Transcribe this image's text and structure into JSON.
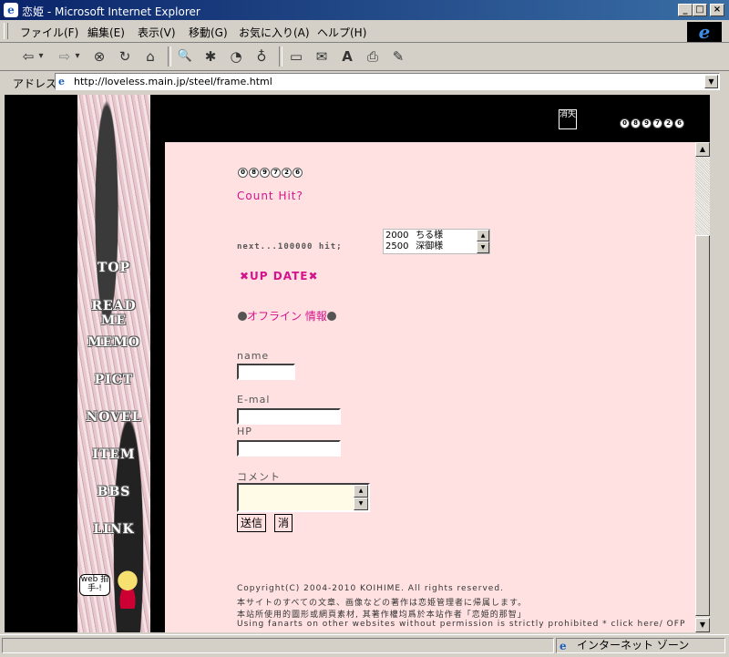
{
  "window": {
    "title": "恋姫 - Microsoft Internet Explorer",
    "controls": {
      "minimize": "_",
      "maximize": "□",
      "close": "×"
    }
  },
  "menubar": {
    "items": [
      "ファイル(F)",
      "編集(E)",
      "表示(V)",
      "移動(G)",
      "お気に入り(A)",
      "ヘルプ(H)"
    ]
  },
  "toolbar": {
    "buttons": [
      {
        "name": "back-icon",
        "glyph": "⇦"
      },
      {
        "name": "back-dropdown-icon",
        "glyph": "▾"
      },
      {
        "name": "forward-icon",
        "glyph": "⇨"
      },
      {
        "name": "forward-dropdown-icon",
        "glyph": "▾"
      },
      {
        "name": "stop-icon",
        "glyph": "⊗"
      },
      {
        "name": "refresh-icon",
        "glyph": "↻"
      },
      {
        "name": "home-icon",
        "glyph": "⌂"
      },
      {
        "name": "search-icon",
        "glyph": "🔍"
      },
      {
        "name": "favorites-icon",
        "glyph": "✱"
      },
      {
        "name": "history-icon",
        "glyph": "◔"
      },
      {
        "name": "channels-icon",
        "glyph": "♁"
      },
      {
        "name": "fullscreen-icon",
        "glyph": "▭"
      },
      {
        "name": "mail-icon",
        "glyph": "✉"
      },
      {
        "name": "font-icon",
        "glyph": "A"
      },
      {
        "name": "print-icon",
        "glyph": "⎙"
      },
      {
        "name": "edit-icon",
        "glyph": "✎"
      }
    ]
  },
  "address": {
    "label": "アドレス",
    "url": "http://loveless.main.jp/steel/frame.html"
  },
  "sidebar": {
    "links": [
      "TOP",
      "READ ME",
      "MEMO",
      "PICT",
      "NOVEL",
      "ITEM",
      "BBS",
      "LINK"
    ],
    "web_clap": "web 拍手-!"
  },
  "header": {
    "icon_text": "消失",
    "counter_digits": [
      "0",
      "8",
      "9",
      "7",
      "2",
      "6"
    ]
  },
  "content": {
    "counter_digits": [
      "0",
      "8",
      "9",
      "7",
      "2",
      "6"
    ],
    "count_hit": "Count Hit?",
    "next_label": "next...100000 hit;",
    "ranking": [
      {
        "count": "2000",
        "name": "ちる様"
      },
      {
        "count": "2500",
        "name": "深御様"
      }
    ],
    "update": "✖UP DATE✖",
    "offline": "オフライン 情報",
    "form": {
      "name_label": "name",
      "email_label": "E-mal",
      "hp_label": "HP",
      "comment_label": "コメント",
      "submit": "送信",
      "clear": "消"
    },
    "copyright": [
      "Copyright(C) 2004-2010 KOIHIME. All rights reserved.",
      "本サイトのすべての文章、画像などの著作は恋姫管理者に帰属します。",
      "本站所使用的圖形或網頁素材, 其著作權均爲於本站作者「恋姫的那智」"
    ],
    "notice": "Using fanarts on other websites without permission is strictly prohibited * click here/ OFP"
  },
  "status": {
    "zone": "インターネット ゾーン"
  },
  "colors": {
    "content_bg": "#ffe1e1",
    "accent": "#d4148c",
    "titlebar": "#0a246a"
  }
}
